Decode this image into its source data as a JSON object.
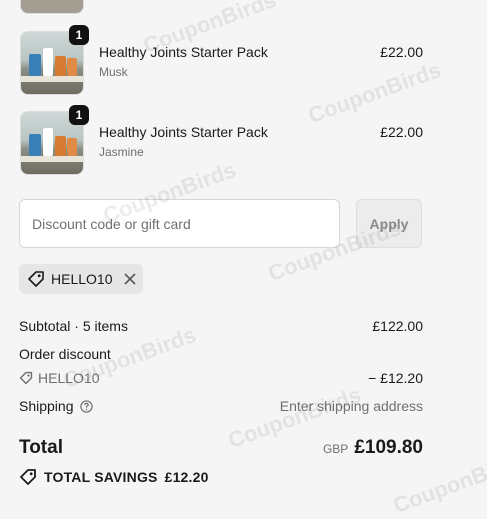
{
  "line_items": [
    {
      "name": "Healthy Joints Starter Pack",
      "variant": "Musk",
      "quantity": "1",
      "price": "£22.00"
    },
    {
      "name": "Healthy Joints Starter Pack",
      "variant": "Jasmine",
      "quantity": "1",
      "price": "£22.00"
    }
  ],
  "discount": {
    "placeholder": "Discount code or gift card",
    "value": "",
    "apply_label": "Apply",
    "applied_code": "HELLO10"
  },
  "summary": {
    "subtotal_label": "Subtotal · 5 items",
    "subtotal_value": "£122.00",
    "order_discount_label": "Order discount",
    "discount_code": "HELLO10",
    "discount_value": "− £12.20",
    "shipping_label": "Shipping",
    "shipping_value": "Enter shipping address",
    "total_label": "Total",
    "currency": "GBP",
    "total_value": "£109.80",
    "savings_label": "TOTAL SAVINGS",
    "savings_value": "£12.20"
  },
  "watermark": "CouponBirds",
  "colors": {
    "background": "#f5f5f5",
    "text": "#1a1a1a",
    "muted": "#707070",
    "badge": "#111111"
  }
}
